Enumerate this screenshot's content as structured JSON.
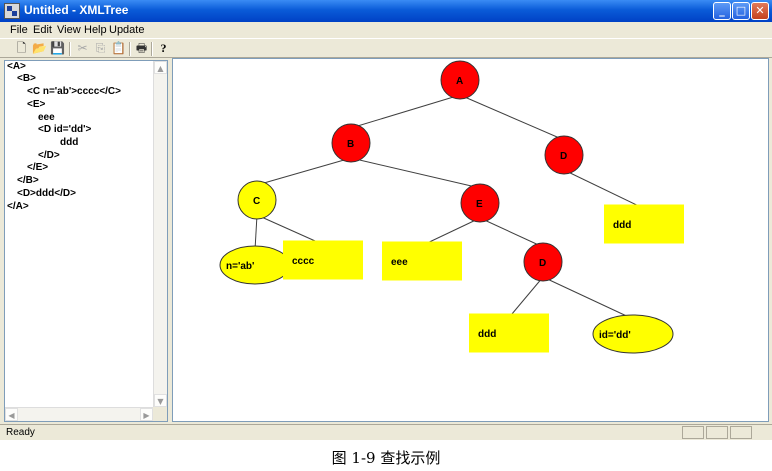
{
  "window": {
    "title": "Untitled - XMLTree",
    "min_glyph": "_",
    "max_glyph": "□",
    "close_glyph": "✕"
  },
  "menu": [
    "File",
    "Edit",
    "View",
    "Help",
    "Update"
  ],
  "toolbar": [
    "new-icon",
    "open-icon",
    "save-icon",
    "cut-icon",
    "copy-icon",
    "paste-icon",
    "print-icon",
    "help-icon"
  ],
  "xml_lines": [
    "<A>",
    "<B>",
    "<C n='ab'>cccc</C>",
    "<E>",
    "eee",
    "<D id='dd'>",
    "ddd",
    "</D>",
    "</E>",
    "</B>",
    "<D>ddd</D>",
    "</A>"
  ],
  "tree": {
    "nodes": [
      {
        "id": "A",
        "label": "A",
        "kind": "element",
        "color": "#ff0000"
      },
      {
        "id": "B",
        "label": "B",
        "kind": "element",
        "color": "#ff0000"
      },
      {
        "id": "D2",
        "label": "D",
        "kind": "element",
        "color": "#ff0000"
      },
      {
        "id": "C",
        "label": "C",
        "kind": "element",
        "color": "#ffff00"
      },
      {
        "id": "E",
        "label": "E",
        "kind": "element",
        "color": "#ff0000"
      },
      {
        "id": "D1",
        "label": "D",
        "kind": "element",
        "color": "#ff0000"
      },
      {
        "id": "nab",
        "label": "n='ab'",
        "kind": "attribute",
        "color": "#ffff00"
      },
      {
        "id": "cccc",
        "label": "cccc",
        "kind": "text",
        "color": "#ffff00"
      },
      {
        "id": "eee",
        "label": "eee",
        "kind": "text",
        "color": "#ffff00"
      },
      {
        "id": "ddd1",
        "label": "ddd",
        "kind": "text",
        "color": "#ffff00"
      },
      {
        "id": "iddd",
        "label": "id='dd'",
        "kind": "attribute",
        "color": "#ffff00"
      },
      {
        "id": "ddd2",
        "label": "ddd",
        "kind": "text",
        "color": "#ffff00"
      }
    ],
    "edges": [
      [
        "A",
        "B"
      ],
      [
        "A",
        "D2"
      ],
      [
        "B",
        "C"
      ],
      [
        "B",
        "E"
      ],
      [
        "C",
        "nab"
      ],
      [
        "C",
        "cccc"
      ],
      [
        "E",
        "eee"
      ],
      [
        "E",
        "D1"
      ],
      [
        "D1",
        "ddd1"
      ],
      [
        "D1",
        "iddd"
      ],
      [
        "D2",
        "ddd2"
      ]
    ]
  },
  "status": {
    "text": "Ready"
  },
  "caption": "图 1-9 查找示例"
}
